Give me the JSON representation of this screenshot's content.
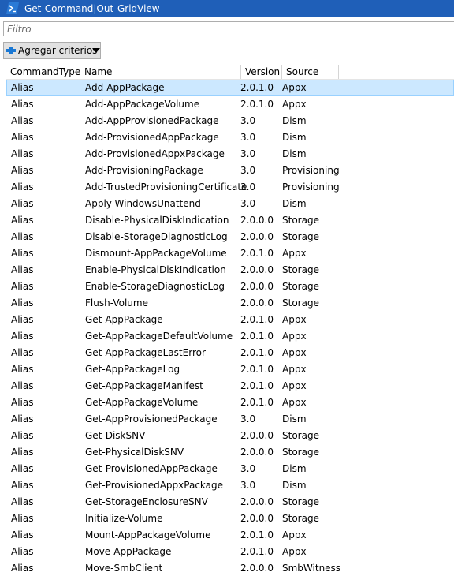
{
  "window": {
    "title": "Get-Command|Out-GridView",
    "icon": "powershell-icon",
    "titlebar_color": "#1f5fb8"
  },
  "filter": {
    "placeholder": "Filtro",
    "value": ""
  },
  "toolbar": {
    "add_criteria_label": "Agregar criterios",
    "add_icon": "plus-icon",
    "dropdown_icon": "caret-down-icon"
  },
  "grid": {
    "columns": [
      "CommandType",
      "Name",
      "Version",
      "Source"
    ],
    "selected_row": 0,
    "selection_color": "#cce8ff",
    "rows": [
      [
        "Alias",
        "Add-AppPackage",
        "2.0.1.0",
        "Appx"
      ],
      [
        "Alias",
        "Add-AppPackageVolume",
        "2.0.1.0",
        "Appx"
      ],
      [
        "Alias",
        "Add-AppProvisionedPackage",
        "3.0",
        "Dism"
      ],
      [
        "Alias",
        "Add-ProvisionedAppPackage",
        "3.0",
        "Dism"
      ],
      [
        "Alias",
        "Add-ProvisionedAppxPackage",
        "3.0",
        "Dism"
      ],
      [
        "Alias",
        "Add-ProvisioningPackage",
        "3.0",
        "Provisioning"
      ],
      [
        "Alias",
        "Add-TrustedProvisioningCertificate",
        "3.0",
        "Provisioning"
      ],
      [
        "Alias",
        "Apply-WindowsUnattend",
        "3.0",
        "Dism"
      ],
      [
        "Alias",
        "Disable-PhysicalDiskIndication",
        "2.0.0.0",
        "Storage"
      ],
      [
        "Alias",
        "Disable-StorageDiagnosticLog",
        "2.0.0.0",
        "Storage"
      ],
      [
        "Alias",
        "Dismount-AppPackageVolume",
        "2.0.1.0",
        "Appx"
      ],
      [
        "Alias",
        "Enable-PhysicalDiskIndication",
        "2.0.0.0",
        "Storage"
      ],
      [
        "Alias",
        "Enable-StorageDiagnosticLog",
        "2.0.0.0",
        "Storage"
      ],
      [
        "Alias",
        "Flush-Volume",
        "2.0.0.0",
        "Storage"
      ],
      [
        "Alias",
        "Get-AppPackage",
        "2.0.1.0",
        "Appx"
      ],
      [
        "Alias",
        "Get-AppPackageDefaultVolume",
        "2.0.1.0",
        "Appx"
      ],
      [
        "Alias",
        "Get-AppPackageLastError",
        "2.0.1.0",
        "Appx"
      ],
      [
        "Alias",
        "Get-AppPackageLog",
        "2.0.1.0",
        "Appx"
      ],
      [
        "Alias",
        "Get-AppPackageManifest",
        "2.0.1.0",
        "Appx"
      ],
      [
        "Alias",
        "Get-AppPackageVolume",
        "2.0.1.0",
        "Appx"
      ],
      [
        "Alias",
        "Get-AppProvisionedPackage",
        "3.0",
        "Dism"
      ],
      [
        "Alias",
        "Get-DiskSNV",
        "2.0.0.0",
        "Storage"
      ],
      [
        "Alias",
        "Get-PhysicalDiskSNV",
        "2.0.0.0",
        "Storage"
      ],
      [
        "Alias",
        "Get-ProvisionedAppPackage",
        "3.0",
        "Dism"
      ],
      [
        "Alias",
        "Get-ProvisionedAppxPackage",
        "3.0",
        "Dism"
      ],
      [
        "Alias",
        "Get-StorageEnclosureSNV",
        "2.0.0.0",
        "Storage"
      ],
      [
        "Alias",
        "Initialize-Volume",
        "2.0.0.0",
        "Storage"
      ],
      [
        "Alias",
        "Mount-AppPackageVolume",
        "2.0.1.0",
        "Appx"
      ],
      [
        "Alias",
        "Move-AppPackage",
        "2.0.1.0",
        "Appx"
      ],
      [
        "Alias",
        "Move-SmbClient",
        "2.0.0.0",
        "SmbWitness"
      ]
    ]
  }
}
